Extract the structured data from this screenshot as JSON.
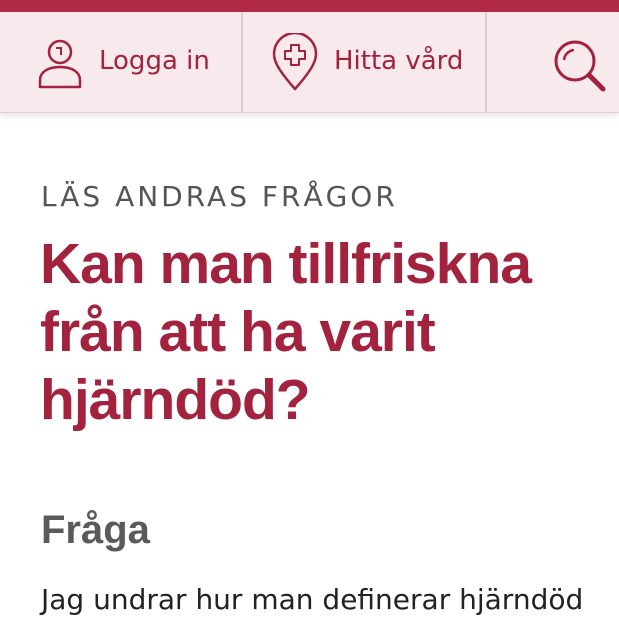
{
  "brand": {
    "accent_color": "#b12b46",
    "text_color": "#a3233e",
    "nav_background": "#f8eaec"
  },
  "nav": {
    "login": {
      "label": "Logga in",
      "icon": "user-icon"
    },
    "find_care": {
      "label": "Hitta vård",
      "icon": "location-cross-icon"
    },
    "search": {
      "icon": "search-icon"
    }
  },
  "article": {
    "eyebrow": "LÄS ANDRAS FRÅGOR",
    "title": "Kan man tillfriskna från att ha varit hjärndöd?",
    "question_heading": "Fråga",
    "question_text": "Jag undrar hur man definerar hjärndöd"
  }
}
